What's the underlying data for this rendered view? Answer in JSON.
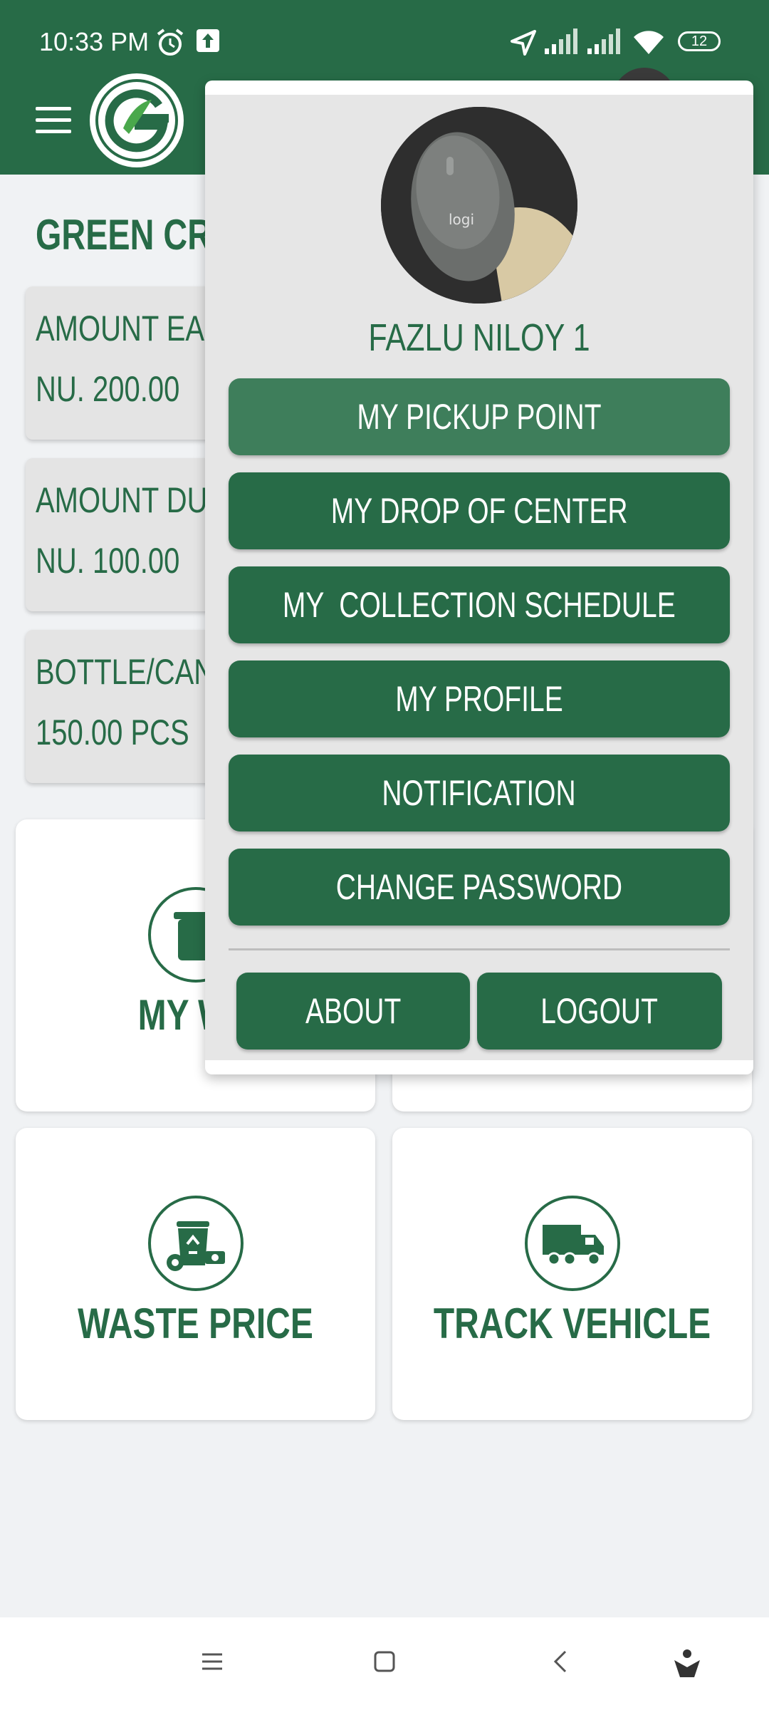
{
  "status_bar": {
    "time": "10:33 PM",
    "battery": "12"
  },
  "dashboard": {
    "heading": "GREEN CRE",
    "stats": [
      {
        "label": "AMOUNT EARN",
        "value": "NU. 200.00"
      },
      {
        "label": "AMOUNT DUE",
        "value": "NU. 100.00"
      },
      {
        "label": "BOTTLE/CAN",
        "value": "150.00 PCS"
      }
    ],
    "tiles": [
      {
        "label": "MY WA",
        "icon": "waste-bin-icon"
      },
      {
        "label": "",
        "icon": ""
      },
      {
        "label": "WASTE PRICE",
        "icon": "recycle-bin-price-icon"
      },
      {
        "label": "TRACK VEHICLE",
        "icon": "garbage-truck-icon"
      }
    ]
  },
  "menu": {
    "user_name": "FAZLU NILOY 1",
    "items": [
      {
        "label": "MY PICKUP POINT"
      },
      {
        "label": "MY DROP OF CENTER"
      },
      {
        "label": "MY  COLLECTION SCHEDULE"
      },
      {
        "label": "MY PROFILE"
      },
      {
        "label": "NOTIFICATION"
      },
      {
        "label": "CHANGE PASSWORD"
      }
    ],
    "about_label": "ABOUT",
    "logout_label": "LOGOUT"
  },
  "colors": {
    "primary": "#276b47",
    "active": "#3e7e5b",
    "card": "#e4e4e4"
  }
}
